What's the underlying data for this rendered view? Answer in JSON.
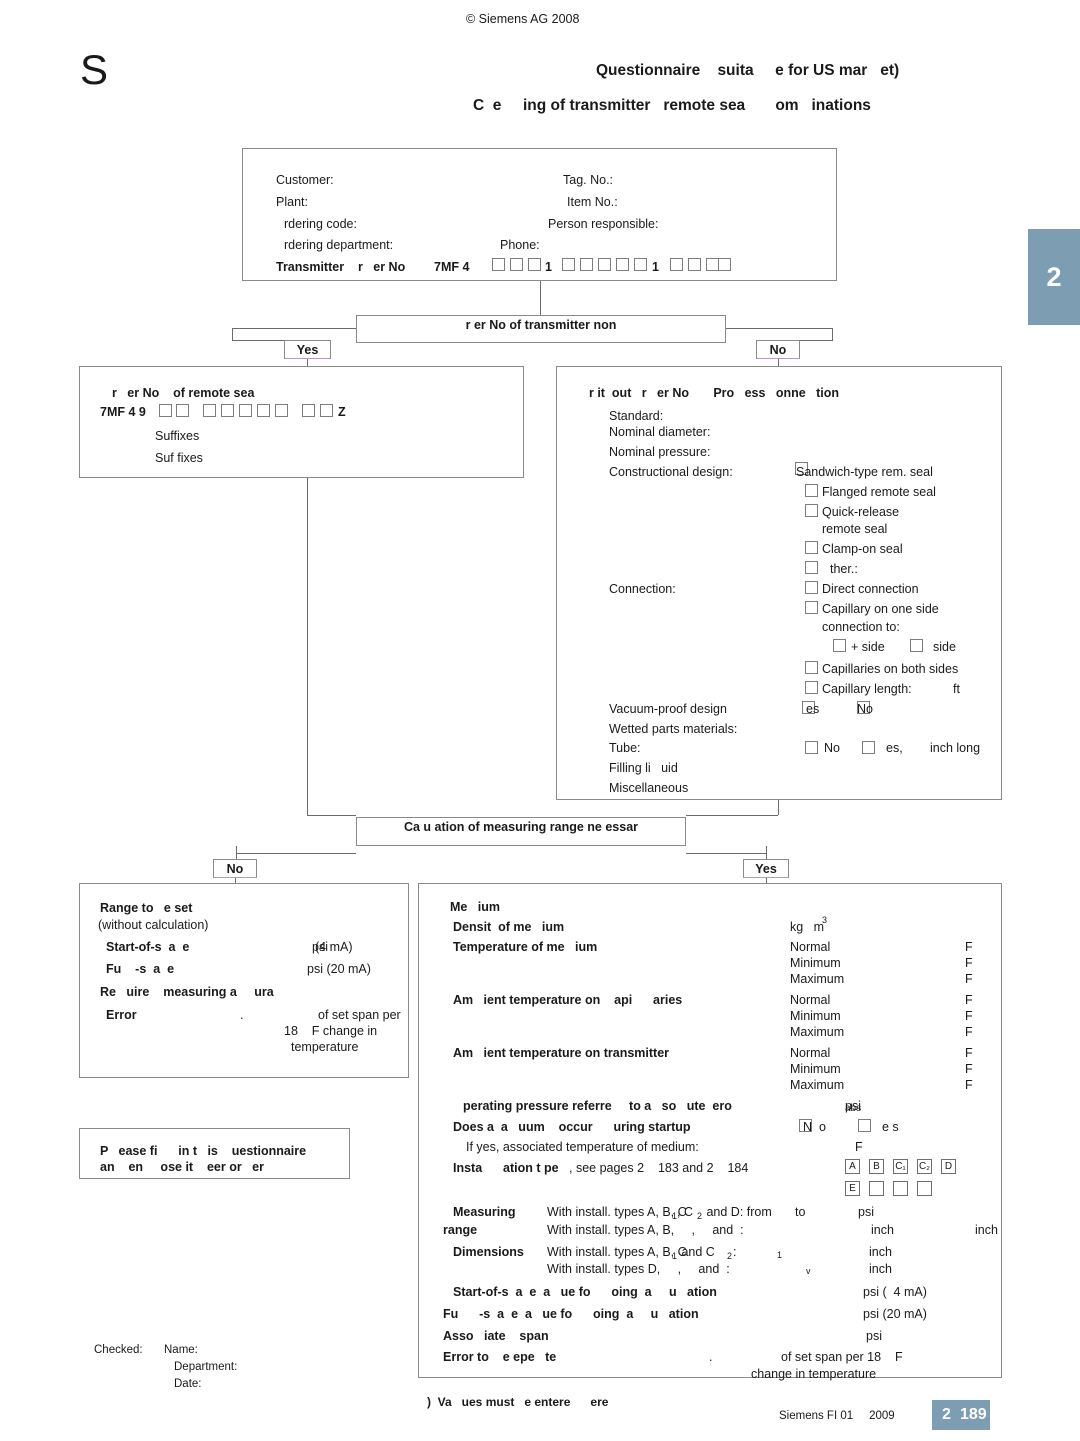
{
  "page": {
    "copyright": "© Siemens AG 2008",
    "big_letter": "S",
    "title_line1": "Questionnaire    suita     e for US mar   et)",
    "title_line2": "C  e     ing of transmitter   remote sea       om   inations",
    "side_tab": "2",
    "footer_note": ")  Va   ues must   e entere      ere",
    "footer_source": "Siemens FI 01     2009",
    "footer_chapter": "2",
    "footer_page": "189"
  },
  "header_box": {
    "customer": "Customer:",
    "plant": "Plant:",
    "ordering_code": "rdering code:",
    "ordering_department": "rdering department:",
    "tag_no": "Tag. No.:",
    "item_no": "Item No.:",
    "person_responsible": "Person responsible:",
    "phone": "Phone:",
    "transmitter_label": "Transmitter    r   er No",
    "transmitter_prefix": "7MF 4",
    "group1_boxes": 3,
    "group1_suffix": "1",
    "group2_boxes": 4,
    "group2_suffix": "1",
    "group3_boxes": 3
  },
  "decision1": {
    "question": "r   er No    of transmitter    non",
    "yes": "Yes",
    "no": "No"
  },
  "seal_box": {
    "title": "r   er No    of remote sea",
    "prefix": "7MF 4 9",
    "group1_boxes": 2,
    "group2_boxes": 5,
    "group3_boxes": 2,
    "suffix_z": "Z",
    "line1": "Suffixes",
    "line2": "Suf fixes"
  },
  "process_box": {
    "title": "r it  out   r   er No       Pro   ess   onne   tion",
    "fields": [
      "Standard:",
      "Nominal diameter:",
      "Nominal pressure:",
      "Constructional design:"
    ],
    "design_options": [
      "Sandwich-type rem. seal",
      "Flanged remote seal",
      "Quick-release",
      "remote seal",
      "Clamp-on seal",
      "ther.:"
    ],
    "connection_label": "Connection:",
    "connection_options": [
      "Direct connection",
      "Capillary on one side",
      "connection to:",
      "+ side",
      "side",
      "Capillaries on both sides",
      "Capillary length:",
      "ft"
    ],
    "vacuum_label": "Vacuum-proof design",
    "vacuum_yes": "es",
    "vacuum_no": "No",
    "wetted_label": "Wetted parts materials:",
    "tube_label": "Tube:",
    "tube_no": "No",
    "tube_yes": "es,",
    "tube_unit": "inch long",
    "filling_label": "Filling li   uid",
    "misc_label": "Miscellaneous"
  },
  "decision2": {
    "question": "Ca      u   ation of measuring range ne   essar",
    "no": "No",
    "yes": "Yes"
  },
  "range_box": {
    "title": "Range to   e set",
    "subtitle": "(without calculation)",
    "rows": [
      {
        "label": "Start-of-s  a  e",
        "value": "psi",
        "value2": "(4 mA)"
      },
      {
        "label": "Fu    -s  a  e",
        "value": "psi (20 mA)"
      }
    ],
    "accuracy_label": "Re   uire    measuring a     ura",
    "error_label": "Error",
    "error_dot": ".",
    "error_text1": "of set span per",
    "error_text2": "18    F change in",
    "error_text3": "temperature"
  },
  "note_box": {
    "line1": "P   ease fi      in t   is    uestionnaire",
    "line2": "an    en     ose it    eer or   er"
  },
  "checked_box": {
    "checked": "Checked:",
    "name": "Name:",
    "department": "Department:",
    "date": "Date:"
  },
  "medium_box": {
    "title": "Me   ium",
    "density_label": "Densit  of me   ium",
    "density_unit": "kg   m",
    "density_exp": "3",
    "temp_medium_label": "Temperature of me   ium",
    "temp_rows": [
      "Normal",
      "Minimum",
      "Maximum"
    ],
    "temp_unit": "F",
    "ambient_cap_label": "Am   ient temperature on    api      aries",
    "ambient_tx_label": "Am   ient temperature on transmitter",
    "op_pressure_label": "perating pressure referre     to a   so   ute  ero",
    "op_pressure_unit": "psi",
    "op_pressure_unit2": "abs",
    "vacuum_q_label": "Does a  a   uum    occur      uring startup",
    "vacuum_q_no": "N  o",
    "vacuum_q_yes": "e s",
    "ifyes_label": "If yes, associated temperature of medium:",
    "ifyes_unit": "F",
    "install_label": "Insta      ation t pe",
    "install_note": ", see pages 2    183 and 2    184",
    "install_row1": [
      "A",
      "B",
      "C₁",
      "C₂",
      "D"
    ],
    "install_row2": [
      "E",
      "",
      "",
      ""
    ],
    "measuring_label1": "Measuring",
    "measuring_label2": "range",
    "measuring_row1": "With install. types A, B, C",
    "measuring_row1_sub": "1",
    "measuring_row1_c2": ", C",
    "measuring_row1_sub2": "2",
    "measuring_row1_end": " and D: from",
    "measuring_row1_to": "to",
    "measuring_row1_unit": "psi",
    "measuring_row2": "With install. types A, B,     ,     and  :",
    "measuring_row2_unit": "inch",
    "measuring_row2_unit2": "inch",
    "dimensions_label": "Dimensions",
    "dimensions_row1": "With install. types A, B, C",
    "dimensions_row1_sub": "1",
    "dimensions_row1_and": " and C",
    "dimensions_row1_sub2": "2",
    "dimensions_row1_colon": ":",
    "dimensions_row1_var": "1",
    "dimensions_row1_unit": "inch",
    "dimensions_row2": "With install. types D,     ,     and  :",
    "dimensions_row2_var": "v",
    "dimensions_row2_unit": "inch",
    "start_calc_label": "Start-of-s  a  e  a   ue fo      oing  a     u   ation",
    "start_calc_unit": "psi (  4 mA)",
    "full_calc_label": "Fu      -s  a  e  a   ue fo      oing  a     u   ation",
    "full_calc_unit": "psi (20 mA)",
    "assoc_span_label": "Asso   iate    span",
    "assoc_span_unit": "psi",
    "error_label": "Error to    e epe   te",
    "error_dot": ".",
    "error_text1": "of set span per 18    F",
    "error_text2": "change in temperature"
  },
  "colors": {
    "tab_blue": "#7d9eb2",
    "border_gray": "#8a8a8a",
    "text": "#1a1a1a"
  }
}
